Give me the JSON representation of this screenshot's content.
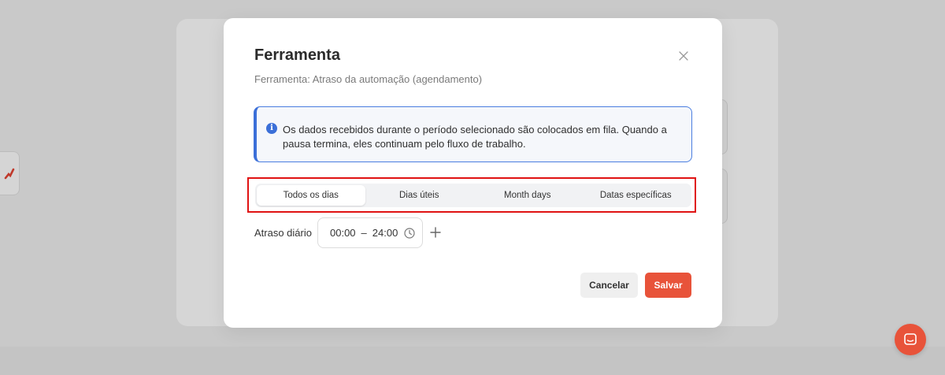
{
  "modal": {
    "title": "Ferramenta",
    "subtitle": "Ferramenta: Atraso da automação (agendamento)",
    "info_text": "Os dados recebidos durante o período selecionado são colocados em fila. Quando a pausa termina, eles continuam pelo fluxo de trabalho.",
    "tabs": [
      {
        "label": "Todos os dias",
        "active": true
      },
      {
        "label": "Dias úteis",
        "active": false
      },
      {
        "label": "Month days",
        "active": false
      },
      {
        "label": "Datas específicas",
        "active": false
      }
    ],
    "delay_label": "Atraso diário",
    "time_start": "00:00",
    "time_separator": "–",
    "time_end": "24:00",
    "cancel_label": "Cancelar",
    "save_label": "Salvar"
  },
  "icons": {
    "close": "close-icon",
    "info": "info-icon",
    "clock": "clock-icon",
    "add": "plus-icon",
    "chat": "chat-icon",
    "app_logo": "logo-icon"
  },
  "colors": {
    "accent": "#e8533a",
    "info_border": "#3b6fd8",
    "highlight": "#e01313"
  }
}
